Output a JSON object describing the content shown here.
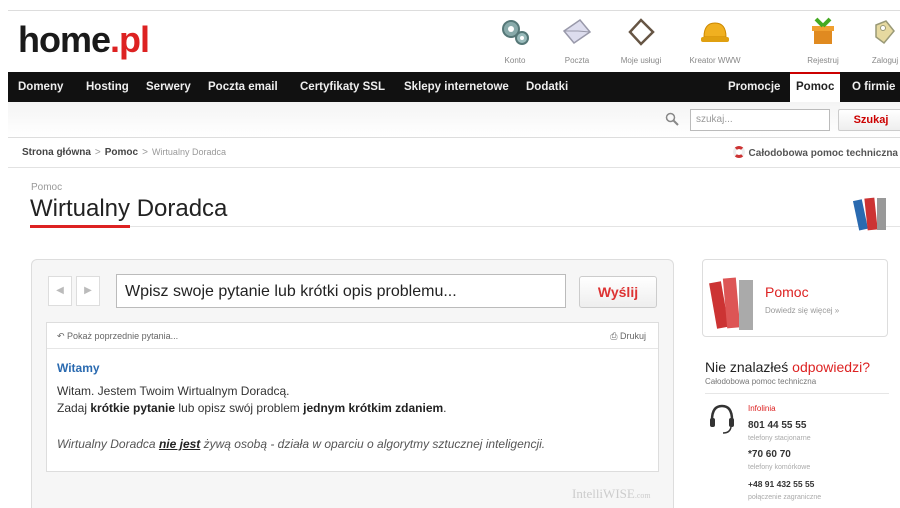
{
  "header": {
    "logo_main": "home",
    "logo_accent": ".pl",
    "icons": [
      {
        "label": "Konto",
        "icon": "gears-icon"
      },
      {
        "label": "Poczta",
        "icon": "mail-icon"
      },
      {
        "label": "Moje usługi",
        "icon": "tag-icon"
      },
      {
        "label": "Kreator WWW",
        "icon": "hardhat-icon"
      },
      {
        "label": "Rejestruj",
        "icon": "gift-icon"
      },
      {
        "label": "Zaloguj",
        "icon": "key-icon"
      }
    ]
  },
  "nav": {
    "left": [
      "Domeny",
      "Hosting",
      "Serwery",
      "Poczta email",
      "Certyfikaty SSL",
      "Sklepy internetowe",
      "Dodatki"
    ],
    "right": [
      "Promocje",
      "Pomoc",
      "O firmie"
    ],
    "active": "Pomoc"
  },
  "search": {
    "placeholder": "szukaj...",
    "button": "Szukaj"
  },
  "breadcrumb": {
    "home": "Strona główna",
    "sep1": ">",
    "help": "Pomoc",
    "sep2": ">",
    "current": "Wirtualny Doradca"
  },
  "support_link": "Całodobowa pomoc techniczna",
  "page": {
    "section": "Pomoc",
    "title": "Wirtualny Doradca"
  },
  "advisor": {
    "question_placeholder": "Wpisz swoje pytanie lub krótki opis problemu...",
    "send_label": "Wyślij",
    "prev_link": "Pokaż poprzednie pytania...",
    "print_label": "Drukuj",
    "greeting_title": "Witamy",
    "line1": "Witam. Jestem Twoim Wirtualnym Doradcą.",
    "line2_a": "Zadaj ",
    "line2_b": "krótkie pytanie",
    "line2_c": " lub opisz swój problem ",
    "line2_d": "jednym krótkim zdaniem",
    "line2_e": ".",
    "note_a": "Wirtualny Doradca ",
    "note_b": "nie jest",
    "note_c": " żywą osobą - działa w oparciu o algorytmy sztucznej inteligencji.",
    "brand_main": "IntelliWISE",
    "brand_suffix": ".com"
  },
  "help_box": {
    "title": "Pomoc",
    "subtitle": "Dowiedz się więcej »"
  },
  "contact": {
    "question_a": "Nie znalazłeś ",
    "question_b": "odpowiedzi?",
    "subtitle": "Całodobowa pomoc techniczna",
    "infoline_label": "Infolinia",
    "phones": [
      {
        "number": "801 44 55 55",
        "desc": "telefony stacjonarne"
      },
      {
        "number": "*70 60 70",
        "desc": "telefony komórkowe"
      },
      {
        "number": "+48 91 432 55 55",
        "desc": "połączenie zagraniczne"
      }
    ]
  },
  "colors": {
    "accent": "#dd2222",
    "nav_bg": "#111111",
    "link_blue": "#2a6ab0"
  }
}
